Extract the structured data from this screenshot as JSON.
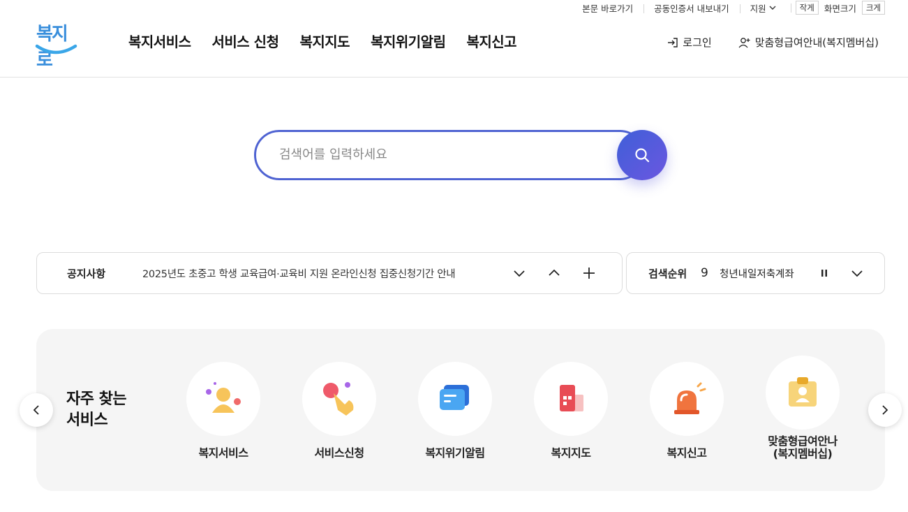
{
  "utility": {
    "skip_link": "본문 바로가기",
    "cert_export": "공동인증서 내보내기",
    "region": "지원",
    "font_small": "작게",
    "font_size_label": "화면크기",
    "font_large": "크게"
  },
  "logo": {
    "text": "복지로"
  },
  "gnb": [
    "복지서비스",
    "서비스 신청",
    "복지지도",
    "복지위기알림",
    "복지신고"
  ],
  "header_right": {
    "login": "로그인",
    "membership": "맞춤형급여안내(복지멤버십)"
  },
  "search": {
    "placeholder": "검색어를 입력하세요",
    "value": ""
  },
  "notice": {
    "label": "공지사항",
    "text": "2025년도 초중고 학생 교육급여·교육비 지원 온라인신청 집중신청기간 안내"
  },
  "ranking": {
    "label": "검색순위",
    "number": "9",
    "keyword": "청년내일저축계좌"
  },
  "quick": {
    "title_line1": "자주 찾는",
    "title_line2": "서비스",
    "items": [
      {
        "label": "복지서비스",
        "icon": "person-icon"
      },
      {
        "label": "서비스신청",
        "icon": "hand-pointer-icon"
      },
      {
        "label": "복지위기알림",
        "icon": "message-icon"
      },
      {
        "label": "복지지도",
        "icon": "building-icon"
      },
      {
        "label": "복지신고",
        "icon": "siren-icon"
      },
      {
        "label_line1": "맞춤형급여안나",
        "label_line2": "(복지멤버십)",
        "icon": "id-card-icon"
      }
    ]
  },
  "colors": {
    "accent": "#4f63d2",
    "logo_blue": "#3a8fdc",
    "panel_bg": "#f5f5f5"
  }
}
